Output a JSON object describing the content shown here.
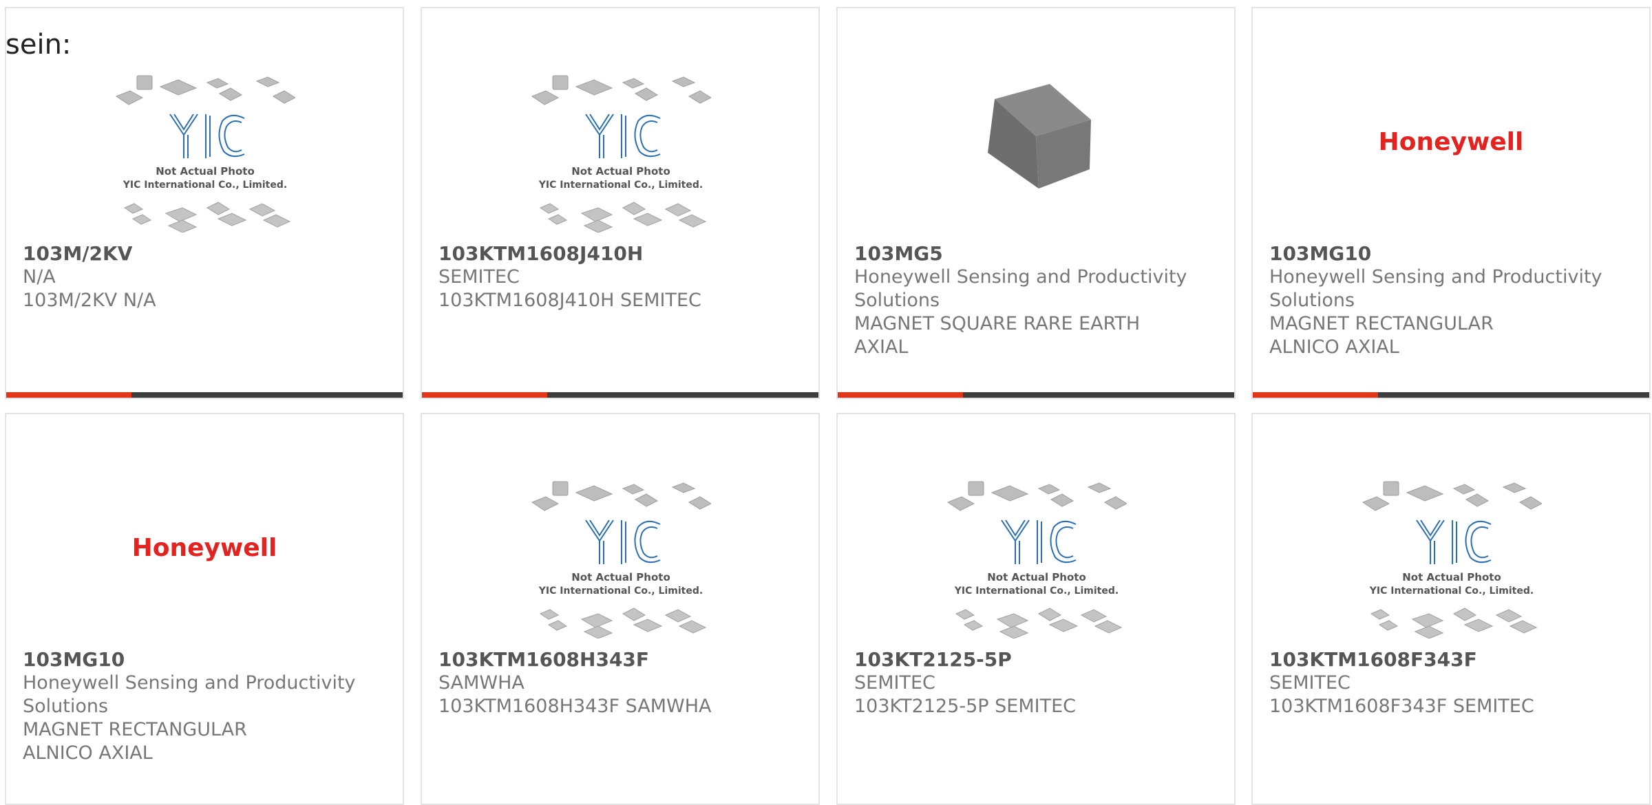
{
  "heading": "sein:",
  "colors": {
    "accent": "#e2361b",
    "bar_dark": "#3d3d3d",
    "border": "#e3e3e3",
    "honeywell_red": "#e3231f"
  },
  "placeholder_image": {
    "line1": "Not Actual Photo",
    "line2": "YIC International Co., Limited.",
    "logo_text": "YIC"
  },
  "brand_logo": "Honeywell",
  "cards": [
    {
      "part": "103M/2KV",
      "manufacturer": "N/A",
      "desc": "103M/2KV N/A",
      "image": "yic-placeholder"
    },
    {
      "part": "103KTM1608J410H",
      "manufacturer": "SEMITEC",
      "desc": "103KTM1608J410H SEMITEC",
      "image": "yic-placeholder"
    },
    {
      "part": "103MG5",
      "manufacturer": "Honeywell Sensing and Productivity Solutions",
      "desc": "MAGNET SQUARE RARE EARTH AXIAL",
      "image": "gray-block"
    },
    {
      "part": "103MG10",
      "manufacturer": "Honeywell Sensing and Productivity Solutions",
      "desc": "MAGNET RECTANGULAR ALNICO AXIAL",
      "image": "honeywell-logo"
    },
    {
      "part": "103MG10",
      "manufacturer": "Honeywell Sensing and Productivity Solutions",
      "desc": "MAGNET RECTANGULAR ALNICO AXIAL",
      "image": "honeywell-logo"
    },
    {
      "part": "103KTM1608H343F",
      "manufacturer": "SAMWHA",
      "desc": "103KTM1608H343F SAMWHA",
      "image": "yic-placeholder"
    },
    {
      "part": "103KT2125-5P",
      "manufacturer": "SEMITEC",
      "desc": "103KT2125-5P SEMITEC",
      "image": "yic-placeholder"
    },
    {
      "part": "103KTM1608F343F",
      "manufacturer": "SEMITEC",
      "desc": "103KTM1608F343F SEMITEC",
      "image": "yic-placeholder"
    }
  ]
}
